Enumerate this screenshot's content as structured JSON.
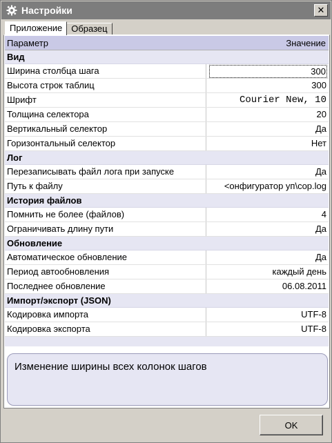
{
  "window": {
    "title": "Настройки",
    "icon": "gear-icon",
    "close_glyph": "✕"
  },
  "tabs": [
    {
      "label": "Приложение",
      "active": true
    },
    {
      "label": "Образец",
      "active": false
    }
  ],
  "grid": {
    "header": {
      "param": "Параметр",
      "value": "Значение"
    },
    "sections": [
      {
        "title": "Вид",
        "rows": [
          {
            "label": "Ширина столбца шага",
            "value": "300"
          },
          {
            "label": "Высота строк таблиц",
            "value": "300"
          },
          {
            "label": "Шрифт",
            "value": "Courier New, 10"
          },
          {
            "label": "Толщина селектора",
            "value": "20"
          },
          {
            "label": "Вертикальный селектор",
            "value": "Да"
          },
          {
            "label": "Горизонтальный селектор",
            "value": "Нет"
          }
        ]
      },
      {
        "title": "Лог",
        "rows": [
          {
            "label": "Перезаписывать файл лога при запуске",
            "value": "Да"
          },
          {
            "label": "Путь к файлу",
            "value": "<онфигуратор уп\\cop.log"
          }
        ]
      },
      {
        "title": "История файлов",
        "rows": [
          {
            "label": "Помнить не более (файлов)",
            "value": "4"
          },
          {
            "label": "Ограничивать длину пути",
            "value": "Да"
          }
        ]
      },
      {
        "title": "Обновление",
        "rows": [
          {
            "label": "Автоматическое обновление",
            "value": "Да"
          },
          {
            "label": "Период автообновления",
            "value": "каждый день"
          },
          {
            "label": "Последнее обновление",
            "value": "06.08.2011"
          }
        ]
      },
      {
        "title": "Импорт/экспорт (JSON)",
        "rows": [
          {
            "label": "Кодировка импорта",
            "value": "UTF-8"
          },
          {
            "label": "Кодировка экспорта",
            "value": "UTF-8"
          }
        ]
      }
    ]
  },
  "description": "Изменение ширины всех колонок шагов",
  "buttons": {
    "ok": "OK"
  }
}
